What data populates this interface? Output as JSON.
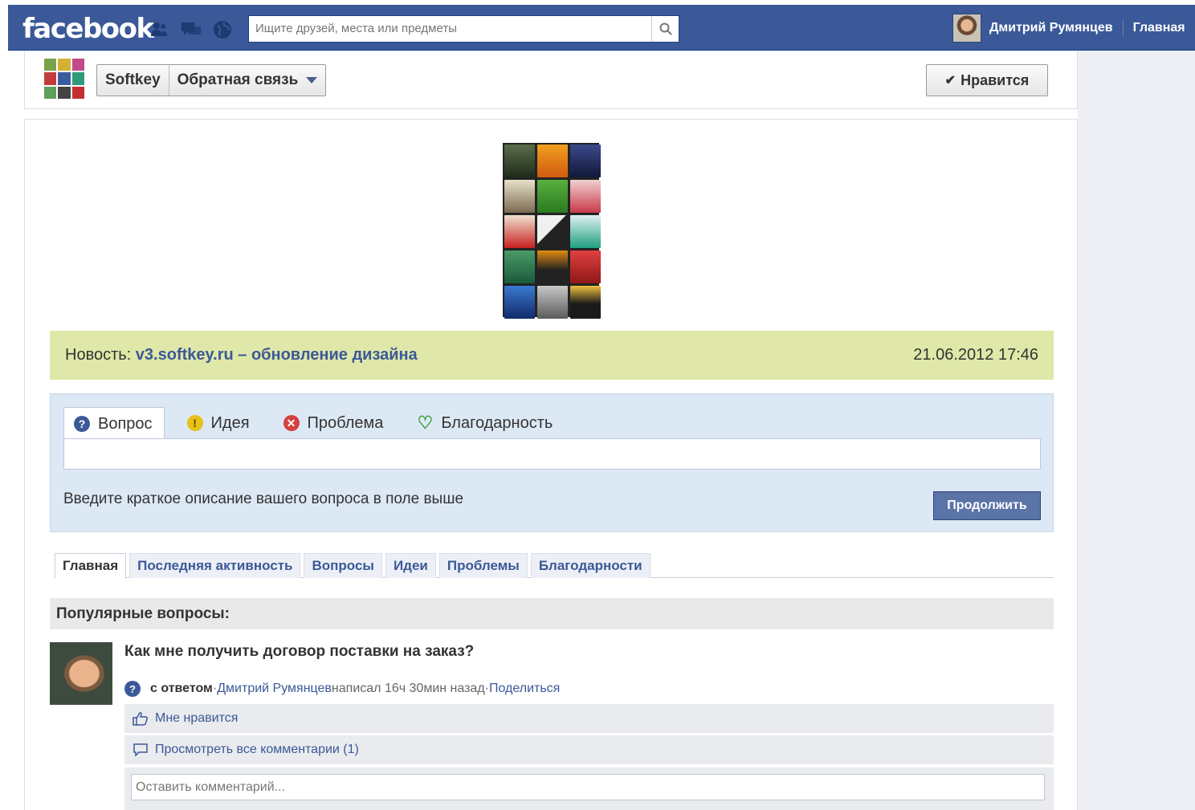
{
  "topbar": {
    "logo": "facebook",
    "search_placeholder": "Ищите друзей, места или предметы",
    "user_name": "Дмитрий Румянцев",
    "home_link": "Главная"
  },
  "page_header": {
    "page_name": "Softkey",
    "section_menu": "Обратная связь",
    "like_button": "Нравится"
  },
  "news": {
    "prefix": "Новость:",
    "link": "v3.softkey.ru – обновление дизайна",
    "date": "21.06.2012 17:46"
  },
  "ask": {
    "tabs": [
      {
        "label": "Вопрос",
        "icon": "question-icon",
        "color": "#3b5998"
      },
      {
        "label": "Идея",
        "icon": "idea-icon",
        "color": "#e8c11a"
      },
      {
        "label": "Проблема",
        "icon": "problem-icon",
        "color": "#d64040"
      },
      {
        "label": "Благодарность",
        "icon": "heart-icon",
        "color": "#3aa03a"
      }
    ],
    "hint": "Введите краткое описание вашего вопроса в поле выше",
    "continue_button": "Продолжить"
  },
  "nav_tabs": [
    "Главная",
    "Последняя активность",
    "Вопросы",
    "Идеи",
    "Проблемы",
    "Благодарности"
  ],
  "popular": {
    "heading": "Популярные вопросы:",
    "question": {
      "title": "Как мне получить договор поставки на заказ?",
      "status": "с ответом",
      "dot1": " · ",
      "author": "Дмитрий Румянцев",
      "posted": " написал 16ч 30мин назад",
      "dot2": " · ",
      "share": "Поделиться",
      "like_action": "Мне нравится",
      "comments_action": "Просмотреть все комментарии (1)",
      "comment_placeholder": "Оставить комментарий..."
    }
  },
  "colors": {
    "topbar": "#3b5998",
    "news_bg": "#dfe8a8",
    "ask_bg": "#dde8f5",
    "link": "#3b5998"
  }
}
